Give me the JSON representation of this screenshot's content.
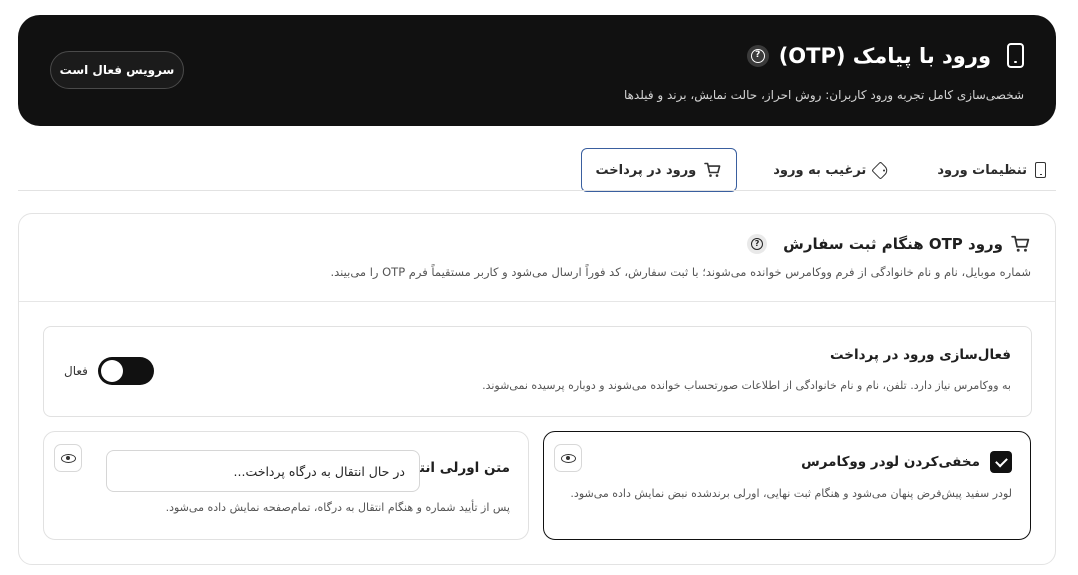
{
  "header": {
    "title": "ورود با پیامک (OTP)",
    "subtitle": "شخصی‌سازی کامل تجربه ورود کاربران: روش احراز، حالت نمایش، برند و فیلدها",
    "service_status": "سرویس فعال است",
    "title_icon": "phone-icon",
    "help_icon": "help-circle-icon"
  },
  "tabs": [
    {
      "label": "تنظیمات ورود",
      "icon": "phone-icon",
      "active": false
    },
    {
      "label": "ترغیب به ورود",
      "icon": "tag-icon",
      "active": false
    },
    {
      "label": "ورود در پرداخت",
      "icon": "cart-icon",
      "active": true
    }
  ],
  "section": {
    "title": "ورود OTP هنگام ثبت سفارش",
    "description": "شماره موبایل، نام و نام خانوادگی از فرم ووکامرس خوانده می‌شوند؛ با ثبت سفارش، کد فوراً ارسال می‌شود و کاربر مستقیماً فرم OTP را می‌بیند.",
    "icon": "cart-icon"
  },
  "activation": {
    "title": "فعال‌سازی ورود در پرداخت",
    "description": "به ووکامرس نیاز دارد. تلفن، نام و نام خانوادگی از اطلاعات صورتحساب خوانده می‌شوند و دوباره پرسیده نمی‌شوند.",
    "toggle_label": "فعال",
    "enabled": true
  },
  "hide_loader": {
    "title": "مخفی‌کردن لودر ووکامرس",
    "description": "لودر سفید پیش‌فرض پنهان می‌شود و هنگام ثبت نهایی، اورلی برندشده نبض نمایش داده می‌شود.",
    "checked": true
  },
  "transfer_text": {
    "label": "متن اورلی انتقال",
    "value": "در حال انتقال به درگاه پرداخت...",
    "description": "پس از تأیید شماره و هنگام انتقال به درگاه، تمام‌صفحه نمایش داده می‌شود."
  }
}
